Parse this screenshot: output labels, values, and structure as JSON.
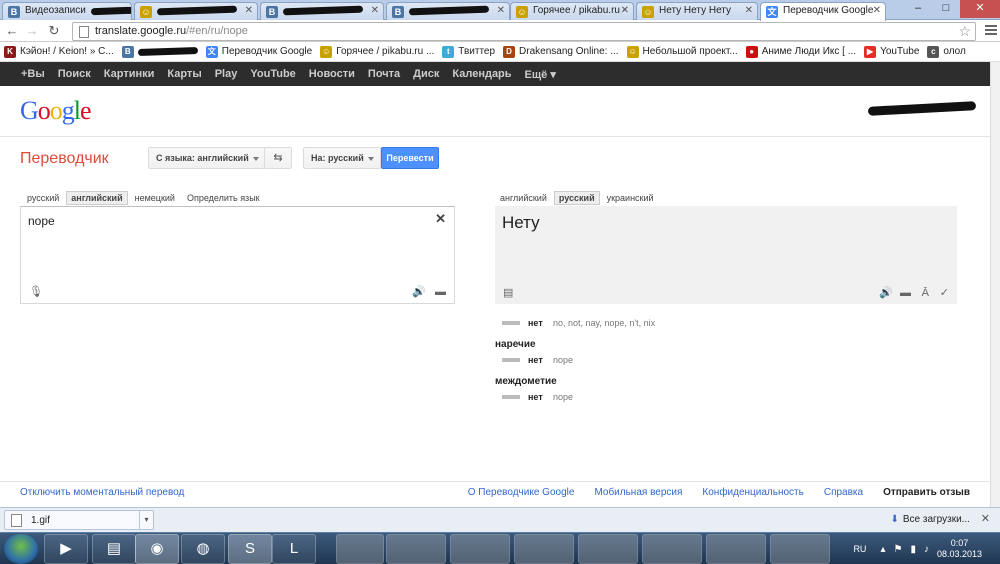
{
  "browser": {
    "tabs": [
      {
        "title": "Видеозаписи",
        "icon": "vk-icon",
        "color": "#4c75a3",
        "letter": "В",
        "hidden": true
      },
      {
        "title": "",
        "icon": "vk-icon",
        "color": "#4c75a3",
        "letter": "В",
        "hidden": true
      },
      {
        "title": "Горячее / pikabu.ru -",
        "icon": "pikabu-icon",
        "color": "#c9a100",
        "letter": "☺"
      },
      {
        "title": "Нету Нету Нету",
        "icon": "pikabu-icon",
        "color": "#c9a100",
        "letter": "☺"
      },
      {
        "title": "Переводчик Google",
        "icon": "google-translate-icon",
        "color": "#4285f4",
        "letter": "文"
      }
    ],
    "window_buttons": {
      "minimize": "–",
      "maximize": "□",
      "close": "✕"
    },
    "url": {
      "host": "translate.google.ru",
      "path": "/#en/ru/nope"
    },
    "bookmarks": [
      {
        "label": "Кэйон! / Keion! » C...",
        "icon": "keion-icon",
        "color": "#8b1a1a",
        "letter": "K"
      },
      {
        "label": "",
        "icon": "vk-icon",
        "color": "#4c75a3",
        "letter": "В"
      },
      {
        "label": "Переводчик Google",
        "icon": "google-translate-icon",
        "color": "#4285f4",
        "letter": "文"
      },
      {
        "label": "Горячее / pikabu.ru ...",
        "icon": "pikabu-icon",
        "color": "#c9a100",
        "letter": "☺"
      },
      {
        "label": "Твиттер",
        "icon": "twitter-icon",
        "color": "#3fa9d8",
        "letter": "t"
      },
      {
        "label": "Drakensang Online: ...",
        "icon": "drakensang-icon",
        "color": "#a3460f",
        "letter": "D"
      },
      {
        "label": "Небольшой проект...",
        "icon": "pikabu-icon",
        "color": "#c9a100",
        "letter": "☺"
      },
      {
        "label": "Аниме Люди Икс [ ...",
        "icon": "anime-icon",
        "color": "#cc1010",
        "letter": "●"
      },
      {
        "label": "YouTube",
        "icon": "youtube-icon",
        "color": "#e52d27",
        "letter": "▶"
      },
      {
        "label": "олол",
        "icon": "misc-icon",
        "color": "#555555",
        "letter": "c"
      }
    ]
  },
  "gbar": {
    "items": [
      "+Вы",
      "Поиск",
      "Картинки",
      "Карты",
      "Play",
      "YouTube",
      "Новости",
      "Почта",
      "Диск",
      "Календарь",
      "Ещё ▾"
    ]
  },
  "header": {
    "logo_letters": [
      "G",
      "o",
      "o",
      "g",
      "l",
      "e"
    ]
  },
  "translator": {
    "title": "Переводчик",
    "from_label": "С языка: английский",
    "swap_icon": "⇆",
    "to_label": "На: русский",
    "translate_button": "Перевести",
    "source_langs": [
      {
        "label": "русский",
        "selected": false
      },
      {
        "label": "английский",
        "selected": true
      },
      {
        "label": "немецкий",
        "selected": false
      },
      {
        "label": "Определить язык",
        "selected": false
      }
    ],
    "target_langs": [
      {
        "label": "английский",
        "selected": false
      },
      {
        "label": "русский",
        "selected": true
      },
      {
        "label": "украинский",
        "selected": false
      }
    ],
    "source_text": "nope",
    "result_text": "Нету"
  },
  "dictionary": {
    "main": {
      "word": "нет",
      "synonyms": "no, not, nay, nope, n't, nix"
    },
    "sections": [
      {
        "pos": "наречие",
        "word": "нет",
        "synonyms": "nope"
      },
      {
        "pos": "междометие",
        "word": "нет",
        "synonyms": "nope"
      }
    ]
  },
  "footer": {
    "left_link": "Отключить моментальный перевод",
    "links": [
      "О Переводчике Google",
      "Мобильная версия",
      "Конфиденциальность",
      "Справка"
    ],
    "feedback": "Отправить отзыв"
  },
  "downloads": {
    "file": "1.gif",
    "all_label": "Все загрузки..."
  },
  "taskbar": {
    "lang": "RU",
    "time": "0:07",
    "date": "08.03.2013"
  }
}
